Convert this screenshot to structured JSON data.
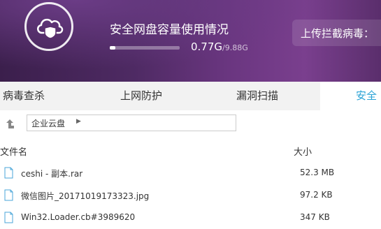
{
  "header": {
    "title": "安全网盘容量使用情况",
    "used": "0.77G",
    "separator": "/",
    "total": "9.88G",
    "usage_fraction": 0.078,
    "virus_label": "上传拦截病毒："
  },
  "tabs": [
    {
      "label": "病毒查杀"
    },
    {
      "label": "上网防护"
    },
    {
      "label": "漏洞扫描"
    },
    {
      "label": "安全"
    }
  ],
  "path": {
    "crumb": "企业云盘"
  },
  "list": {
    "col_name": "文件名",
    "col_size": "大小",
    "rows": [
      {
        "name": "ceshi - 副本.rar",
        "size": "52.3 MB"
      },
      {
        "name": "微信图片_20171019173323.jpg",
        "size": "97.2 KB"
      },
      {
        "name": "Win32.Loader.cb#3989620",
        "size": "347 KB"
      }
    ]
  },
  "colors": {
    "accent": "#2aa3d6",
    "header_purple": "#5a2e6c"
  },
  "icons": [
    "cloud-shield-icon",
    "up-arrow-icon",
    "chevron-right-icon",
    "file-icon"
  ]
}
